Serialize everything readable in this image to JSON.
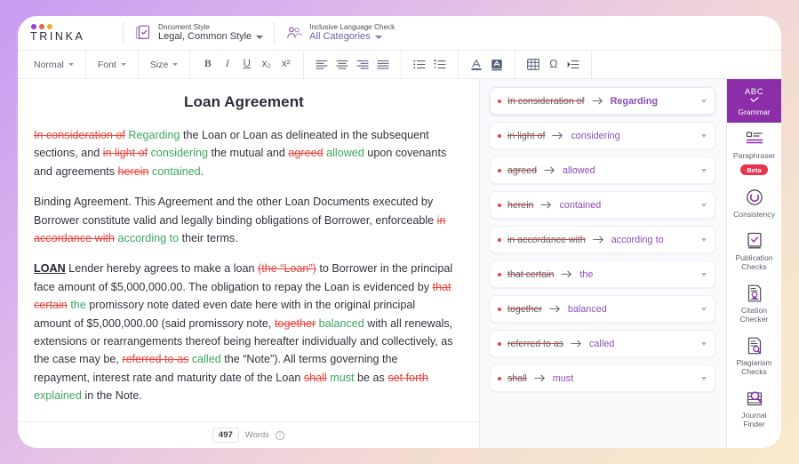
{
  "brand": {
    "name": "TRINKA",
    "dot_colors": [
      "#9b3fd4",
      "#e8674a",
      "#f0a82e"
    ]
  },
  "header": {
    "document_style": {
      "label": "Document Style",
      "value": "Legal, Common Style",
      "icon": "document-style-icon"
    },
    "inclusive_language": {
      "label": "Inclusive Language Check",
      "value": "All Categories",
      "icon": "people-icon"
    }
  },
  "toolbar": {
    "style_dropdown": "Normal",
    "font_dropdown": "Font",
    "size_dropdown": "Size",
    "bold": "B",
    "italic": "I",
    "underline": "U",
    "subscript": "x₂",
    "superscript": "x²",
    "align_left": "align-left-icon",
    "align_center": "align-center-icon",
    "align_right": "align-right-icon",
    "align_justify": "align-justify-icon",
    "bullet_list": "bullet-list-icon",
    "numbered_list": "numbered-list-icon",
    "text_color": "text-color-icon",
    "highlight_color": "highlight-color-icon",
    "insert_table": "table-icon",
    "special_char": "Ω",
    "indent": "indent-icon"
  },
  "document": {
    "title": "Loan Agreement",
    "paragraphs": [
      {
        "id": "p1",
        "runs": [
          {
            "t": "del",
            "v": "In consideration of"
          },
          {
            "t": "sp",
            "v": " "
          },
          {
            "t": "ins",
            "v": "Regarding"
          },
          {
            "t": "txt",
            "v": " the Loan or Loan as delineated in the subsequent sections, and "
          },
          {
            "t": "del",
            "v": "in light of"
          },
          {
            "t": "sp",
            "v": " "
          },
          {
            "t": "ins",
            "v": "considering"
          },
          {
            "t": "txt",
            "v": " the mutual and "
          },
          {
            "t": "del",
            "v": "agreed"
          },
          {
            "t": "sp",
            "v": " "
          },
          {
            "t": "ins",
            "v": "allowed"
          },
          {
            "t": "txt",
            "v": " upon covenants and agreements "
          },
          {
            "t": "del",
            "v": "herein"
          },
          {
            "t": "sp",
            "v": " "
          },
          {
            "t": "ins",
            "v": "contained"
          },
          {
            "t": "txt",
            "v": "."
          }
        ]
      },
      {
        "id": "p2",
        "runs": [
          {
            "t": "txt",
            "v": "Binding Agreement. This Agreement and the other Loan Documents executed by Borrower constitute valid and legally binding obligations of Borrower, enforceable "
          },
          {
            "t": "del",
            "v": "in accordance with"
          },
          {
            "t": "sp",
            "v": " "
          },
          {
            "t": "ins",
            "v": "according to"
          },
          {
            "t": "txt",
            "v": " their terms."
          }
        ]
      },
      {
        "id": "p3",
        "runs": [
          {
            "t": "bold-u",
            "v": "LOAN"
          },
          {
            "t": "txt",
            "v": " Lender hereby agrees to make a loan "
          },
          {
            "t": "del",
            "v": "(the “Loan”)"
          },
          {
            "t": "txt",
            "v": "  to Borrower in the principal face amount of $5,000,000.00. The obligation to repay the Loan is evidenced by "
          },
          {
            "t": "del",
            "v": "that certain"
          },
          {
            "t": "sp",
            "v": " "
          },
          {
            "t": "ins",
            "v": "the"
          },
          {
            "t": "txt",
            "v": " promissory note dated even date here with in the original principal amount of $5,000,000.00 (said promissory note, "
          },
          {
            "t": "del",
            "v": "together"
          },
          {
            "t": "sp",
            "v": " "
          },
          {
            "t": "ins",
            "v": "balanced"
          },
          {
            "t": "txt",
            "v": " with all renewals, extensions or rearrangements thereof being hereafter individually and collectively, as the case may be, "
          },
          {
            "t": "del",
            "v": "referred to as"
          },
          {
            "t": "sp",
            "v": " "
          },
          {
            "t": "ins",
            "v": "called"
          },
          {
            "t": "txt",
            "v": " the “Note”). All terms governing the repayment, interest rate and maturity date of the Loan "
          },
          {
            "t": "del",
            "v": "shall"
          },
          {
            "t": "sp",
            "v": " "
          },
          {
            "t": "ins",
            "v": "must"
          },
          {
            "t": "txt",
            "v": " be as "
          },
          {
            "t": "del",
            "v": "set forth"
          },
          {
            "t": "sp",
            "v": " "
          },
          {
            "t": "ins",
            "v": "explained"
          },
          {
            "t": "txt",
            "v": " in the Note."
          }
        ]
      }
    ],
    "footer": {
      "word_count": "497",
      "word_label": "Words",
      "info_icon": "info-icon"
    }
  },
  "suggestions": [
    {
      "old": "In consideration of",
      "new": "Regarding",
      "active": true
    },
    {
      "old": "in light of",
      "new": "considering",
      "active": false
    },
    {
      "old": "agreed",
      "new": "allowed",
      "active": false
    },
    {
      "old": "herein",
      "new": "contained",
      "active": false
    },
    {
      "old": "in accordance with",
      "new": "according to",
      "active": false
    },
    {
      "old": "that certain",
      "new": "the",
      "active": false
    },
    {
      "old": "together",
      "new": "balanced",
      "active": false
    },
    {
      "old": "referred to as",
      "new": "called",
      "active": false
    },
    {
      "old": "shall",
      "new": "must",
      "active": false
    }
  ],
  "rail": {
    "items": [
      {
        "label": "Grammar",
        "icon": "abc-check-icon",
        "active": true,
        "badge": ""
      },
      {
        "label": "Paraphraser",
        "icon": "paraphraser-icon",
        "active": false,
        "badge": "Beta"
      },
      {
        "label": "Consistency",
        "icon": "consistency-icon",
        "active": false,
        "badge": ""
      },
      {
        "label": "Publication\nChecks",
        "icon": "publication-checks-icon",
        "active": false,
        "badge": ""
      },
      {
        "label": "Citation\nChecker",
        "icon": "citation-checker-icon",
        "active": false,
        "badge": ""
      },
      {
        "label": "Plagiarism\nChecks",
        "icon": "plagiarism-checks-icon",
        "active": false,
        "badge": ""
      },
      {
        "label": "Journal\nFinder",
        "icon": "journal-finder-icon",
        "active": false,
        "badge": ""
      }
    ],
    "abc_text": "ABC"
  },
  "colors": {
    "accent_purple": "#8b2ea8",
    "suggestion_new": "#8e4bb8",
    "deleted_red": "#e8453c",
    "inserted_green": "#3aa760",
    "beta_red": "#e8334d"
  }
}
